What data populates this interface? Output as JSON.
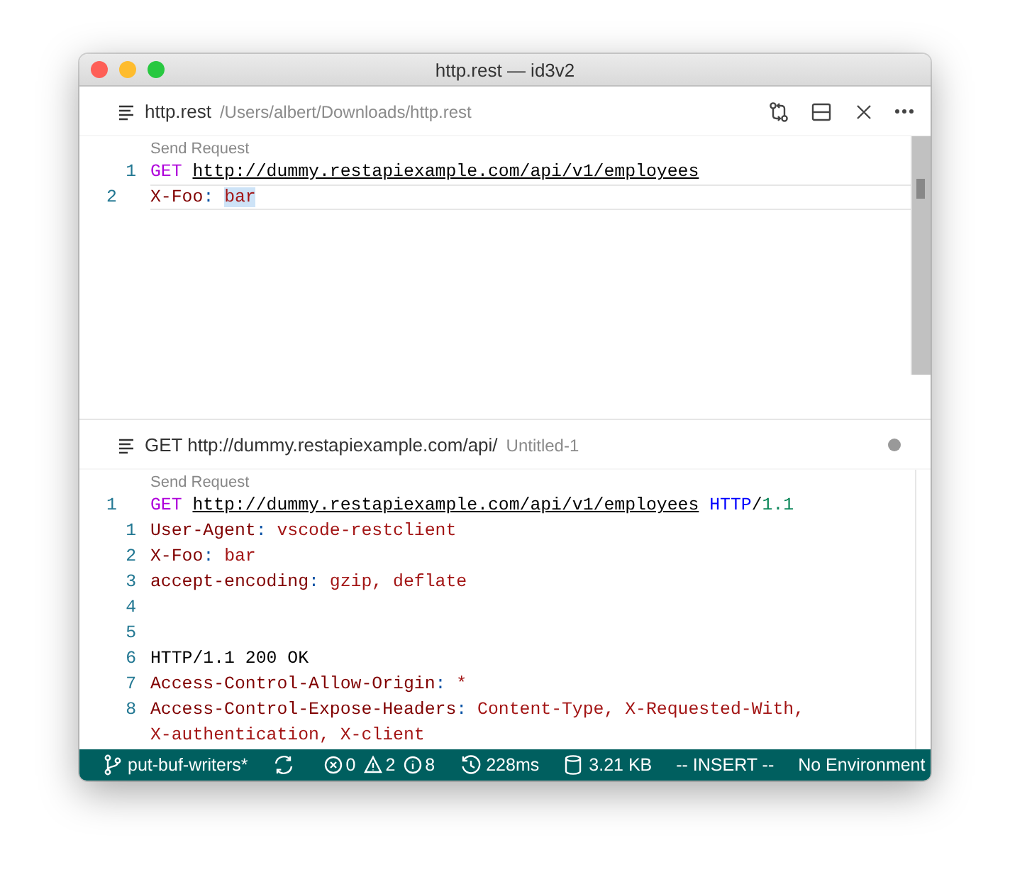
{
  "window": {
    "title": "http.rest — id3v2"
  },
  "editors": [
    {
      "tab": {
        "name": "http.rest",
        "detail": "/Users/albert/Downloads/http.rest",
        "dirty": false,
        "actions": true
      },
      "codelens": "Send Request",
      "scrollbar": true,
      "lines": [
        {
          "number": "1",
          "outdent": false,
          "current": false,
          "tokens": [
            {
              "text": "GET ",
              "kind": "method"
            },
            {
              "text": "http://dummy.restapiexample.com/api/v1/employees",
              "kind": "url"
            }
          ]
        },
        {
          "number": "2",
          "outdent": true,
          "current": true,
          "tokens": [
            {
              "text": "X-Foo",
              "kind": "key"
            },
            {
              "text": ": ",
              "kind": "punct"
            },
            {
              "text": "bar",
              "kind": "value",
              "selected": true
            }
          ]
        }
      ]
    },
    {
      "tab": {
        "name": "GET http://dummy.restapiexample.com/api/",
        "detail": "Untitled-1",
        "dirty": true,
        "actions": false
      },
      "codelens": "Send Request",
      "scrollbar": false,
      "lines": [
        {
          "number": "1",
          "outdent": true,
          "current": false,
          "tokens": [
            {
              "text": "GET ",
              "kind": "method"
            },
            {
              "text": "http://dummy.restapiexample.com/api/v1/employees",
              "kind": "url"
            },
            {
              "text": " HTTP",
              "kind": "proto"
            },
            {
              "text": "/",
              "kind": "plain"
            },
            {
              "text": "1.1",
              "kind": "version"
            }
          ]
        },
        {
          "number": "1",
          "outdent": false,
          "current": false,
          "tokens": [
            {
              "text": "User-Agent",
              "kind": "key"
            },
            {
              "text": ": ",
              "kind": "punct"
            },
            {
              "text": "vscode-restclient",
              "kind": "value"
            }
          ]
        },
        {
          "number": "2",
          "outdent": false,
          "current": false,
          "tokens": [
            {
              "text": "X-Foo",
              "kind": "key"
            },
            {
              "text": ": ",
              "kind": "punct"
            },
            {
              "text": "bar",
              "kind": "value"
            }
          ]
        },
        {
          "number": "3",
          "outdent": false,
          "current": false,
          "tokens": [
            {
              "text": "accept-encoding",
              "kind": "key"
            },
            {
              "text": ": ",
              "kind": "punct"
            },
            {
              "text": "gzip, deflate",
              "kind": "value"
            }
          ]
        },
        {
          "number": "4",
          "outdent": false
        },
        {
          "number": "5",
          "outdent": false
        },
        {
          "number": "6",
          "outdent": false,
          "current": false,
          "tokens": [
            {
              "text": "HTTP/1.1 200 OK",
              "kind": "plain"
            }
          ]
        },
        {
          "number": "7",
          "outdent": false,
          "current": false,
          "tokens": [
            {
              "text": "Access-Control-Allow-Origin",
              "kind": "key"
            },
            {
              "text": ": ",
              "kind": "punct"
            },
            {
              "text": "*",
              "kind": "value"
            }
          ]
        },
        {
          "number": "8",
          "outdent": false,
          "current": false,
          "tokens": [
            {
              "text": "Access-Control-Expose-Headers",
              "kind": "key"
            },
            {
              "text": ": ",
              "kind": "punct"
            },
            {
              "text": "Content-Type, X-Requested-With,",
              "kind": "value"
            }
          ]
        },
        {
          "current": false,
          "tokens": [
            {
              "text": "X-authentication, X-client",
              "kind": "value"
            }
          ]
        }
      ]
    }
  ],
  "status_bar": [
    {
      "kind": "branch",
      "text": "put-buf-writers*"
    },
    {
      "kind": "sync"
    },
    {
      "kind": "problems",
      "errors": "0",
      "warnings": "2",
      "infos": "8"
    },
    {
      "kind": "time",
      "text": "228ms"
    },
    {
      "kind": "size",
      "text": "3.21 KB"
    },
    {
      "kind": "plain",
      "text": "-- INSERT --"
    },
    {
      "kind": "plain",
      "text": "No Environment"
    }
  ]
}
